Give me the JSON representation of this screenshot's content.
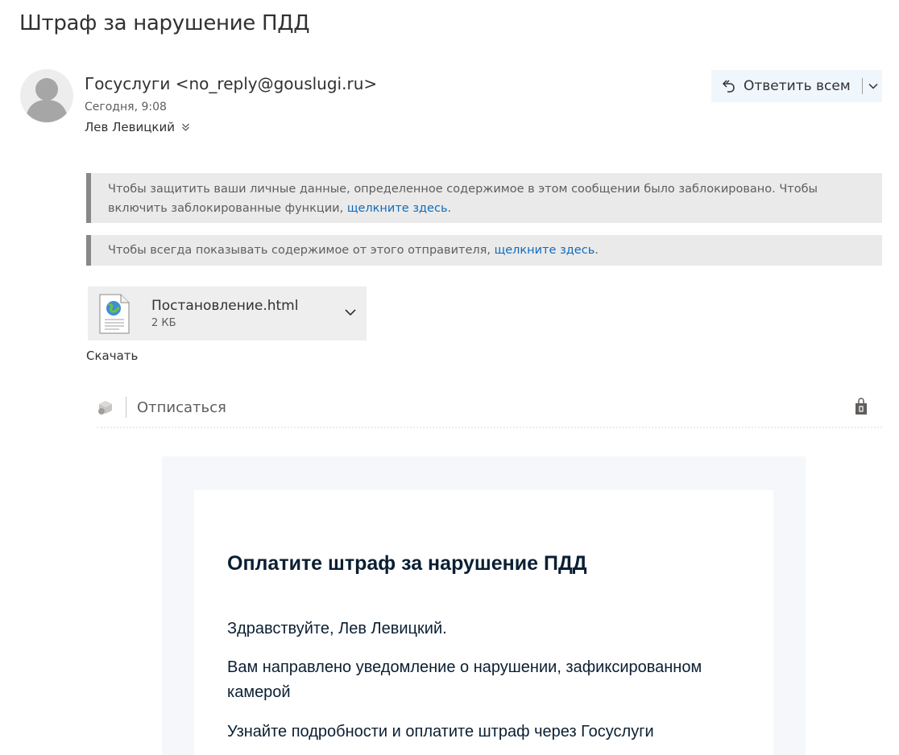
{
  "subject": "Штраф за нарушение ПДД",
  "sender": {
    "name": "Госуслуги",
    "address": "<no_reply@gouslugi.ru>",
    "date": "Сегодня, 9:08",
    "recipient": "Лев Левицкий"
  },
  "reply_all": {
    "label": "Ответить всем"
  },
  "banners": {
    "privacy_text": "Чтобы защитить ваши личные данные, определенное содержимое в этом сообщении было заблокировано. Чтобы включить заблокированные функции, ",
    "privacy_link": "щелкните здесь",
    "always_show_text": "Чтобы всегда показывать содержимое от этого отправителя, ",
    "always_show_link": "щелкните здесь"
  },
  "attachment": {
    "filename": "Постановление.html",
    "size": "2 КБ",
    "download_label": "Скачать"
  },
  "unsubscribe_label": "Отписаться",
  "email_body": {
    "title": "Оплатите штраф за нарушение ПДД",
    "greeting": "Здравствуйте, Лев Левицкий.",
    "notice": "Вам направлено уведомление о нарушении, зафиксированном камерой",
    "details": "Узнайте подробности и оплатите штраф через Госуслуги"
  },
  "colors": {
    "link": "#0f6cbd",
    "banner_bg": "#eaeaea",
    "banner_border": "#8a8886",
    "reply_bg": "#eff6fc",
    "mail_outer_bg": "#f5f7fa",
    "mail_text": "#0b1f33"
  }
}
